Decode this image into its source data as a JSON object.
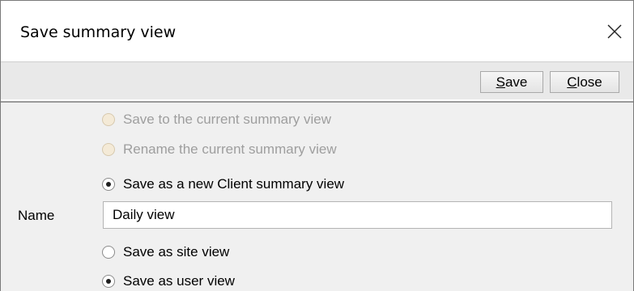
{
  "dialog": {
    "title": "Save summary view",
    "close_icon": "close-icon"
  },
  "toolbar": {
    "save_label_mnemonic": "S",
    "save_label_rest": "ave",
    "close_label_mnemonic": "C",
    "close_label_rest": "lose"
  },
  "options": {
    "save_current": {
      "label": "Save to the current summary view",
      "checked": false,
      "enabled": false
    },
    "rename_current": {
      "label": "Rename the current summary view",
      "checked": false,
      "enabled": false
    },
    "save_new_client": {
      "label": "Save as a new Client summary view",
      "checked": true,
      "enabled": true
    },
    "site_view": {
      "label": "Save as site view",
      "checked": false,
      "enabled": true
    },
    "user_view": {
      "label": "Save as user view",
      "checked": true,
      "enabled": true
    }
  },
  "name_field": {
    "label": "Name",
    "value": "Daily view"
  }
}
